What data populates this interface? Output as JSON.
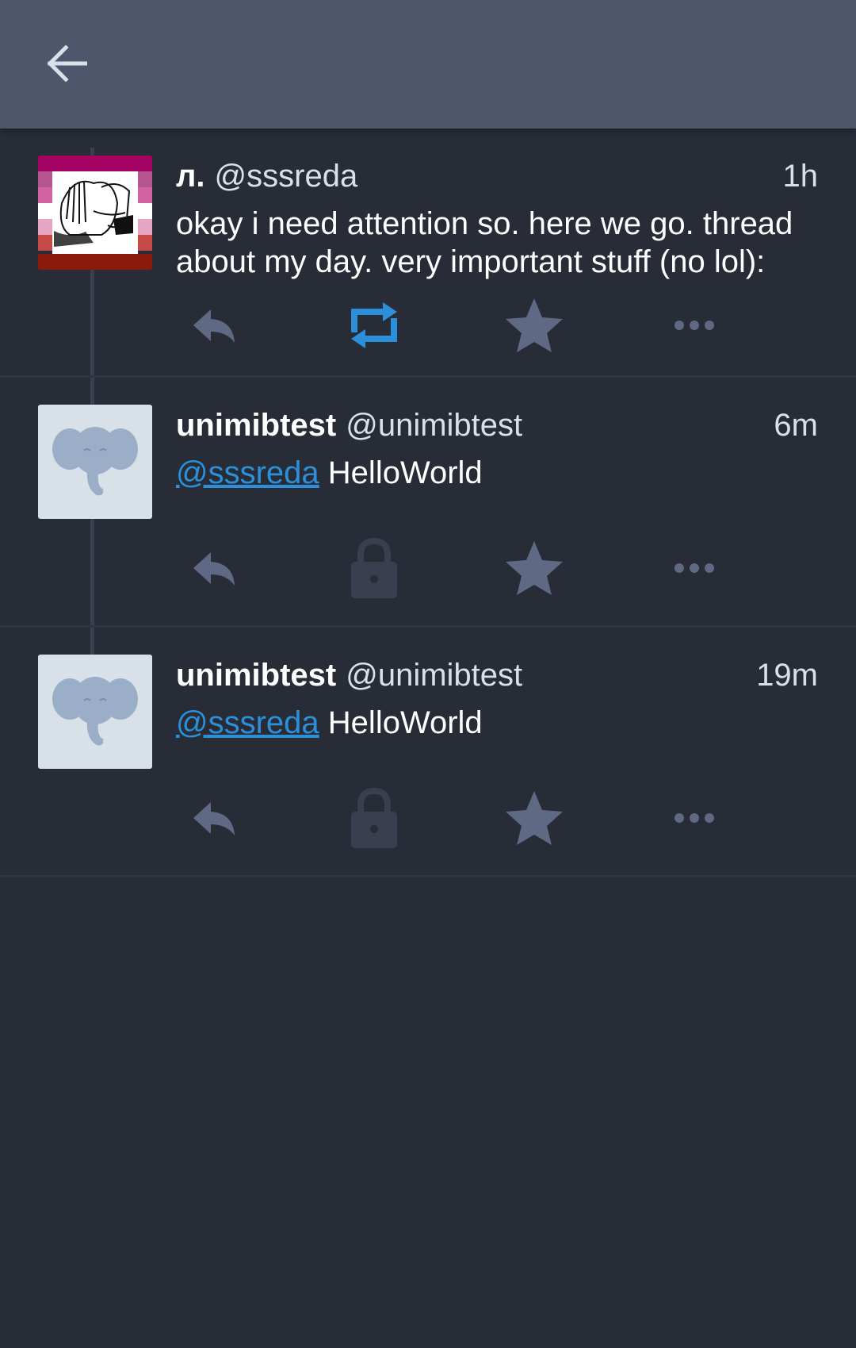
{
  "appbar": {
    "back_icon": "arrow-left-icon"
  },
  "colors": {
    "background": "#282c37",
    "appbar": "#4f566c",
    "action_icon": "#606984",
    "reblog_active": "#2b90d9",
    "locked_icon": "#393f4f",
    "mention": "#2b90d9"
  },
  "statuses": [
    {
      "display_name": "л.",
      "acct": "@sssreda",
      "time": "1h",
      "content": "okay i need attention so. here we go. thread about my day. very important stuff (no lol):",
      "avatar": "pride-flag-drawing-avatar",
      "actions": {
        "reply": "reply-icon",
        "boost": "retweet-icon",
        "boost_state": "active",
        "favourite": "star-icon",
        "more": "ellipsis-icon"
      }
    },
    {
      "display_name": "unimibtest",
      "acct": "@unimibtest",
      "time": "6m",
      "mention": "@sssreda",
      "content": "HelloWorld",
      "avatar": "elephant-avatar",
      "actions": {
        "reply": "reply-icon",
        "boost": "lock-icon",
        "boost_state": "disabled",
        "favourite": "star-icon",
        "more": "ellipsis-icon"
      }
    },
    {
      "display_name": "unimibtest",
      "acct": "@unimibtest",
      "time": "19m",
      "mention": "@sssreda",
      "content": "HelloWorld",
      "avatar": "elephant-avatar",
      "actions": {
        "reply": "reply-icon",
        "boost": "lock-icon",
        "boost_state": "disabled",
        "favourite": "star-icon",
        "more": "ellipsis-icon"
      }
    }
  ]
}
